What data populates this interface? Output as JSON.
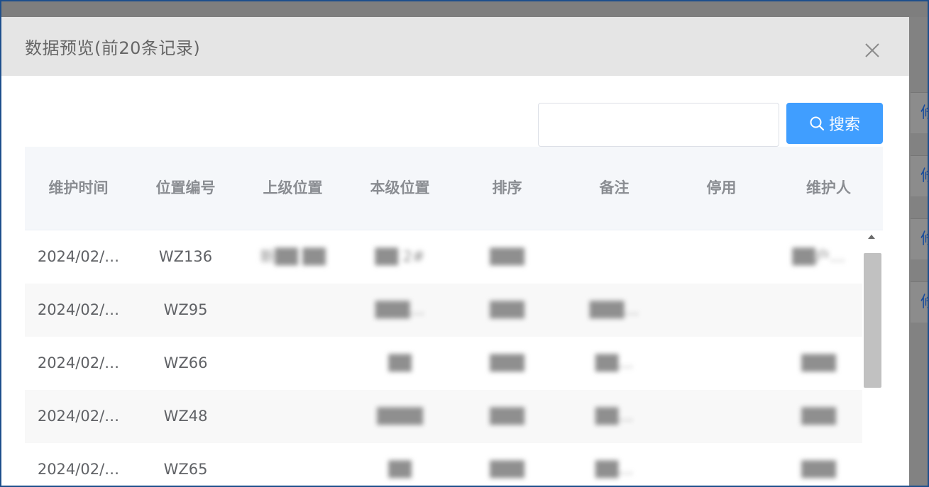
{
  "background": {
    "right_cells": [
      "修",
      "修",
      "修",
      "修"
    ]
  },
  "dialog": {
    "title": "数据预览(前20条记录)",
    "close_icon": "close-icon",
    "search": {
      "value": "",
      "placeholder": "",
      "button_label": "搜索",
      "button_icon": "search-icon"
    }
  },
  "table": {
    "columns": [
      "维护时间",
      "位置编号",
      "上级位置",
      "本级位置",
      "排序",
      "备注",
      "停用",
      "维护人"
    ],
    "rows": [
      {
        "time": "2024/02/…",
        "code": "WZ136",
        "parent": "新██ ██",
        "self": "██ 2#",
        "sort": "███",
        "remark": "",
        "disabled": "",
        "maintainer": "██户… "
      },
      {
        "time": "2024/02/…",
        "code": "WZ95",
        "parent": "",
        "self": "███…",
        "sort": "███",
        "remark": "███…",
        "disabled": "",
        "maintainer": ""
      },
      {
        "time": "2024/02/…",
        "code": "WZ66",
        "parent": "",
        "self": "██",
        "sort": "███",
        "remark": "██…",
        "disabled": "",
        "maintainer": "███"
      },
      {
        "time": "2024/02/…",
        "code": "WZ48",
        "parent": "",
        "self": "████",
        "sort": "███",
        "remark": "██…",
        "disabled": "",
        "maintainer": "███"
      },
      {
        "time": "2024/02/…",
        "code": "WZ65",
        "parent": "",
        "self": "██",
        "sort": "███",
        "remark": "██…",
        "disabled": "",
        "maintainer": "███"
      }
    ]
  },
  "colors": {
    "primary": "#409eff",
    "header_bg": "#e5e5e5",
    "overlay": "#828282"
  }
}
